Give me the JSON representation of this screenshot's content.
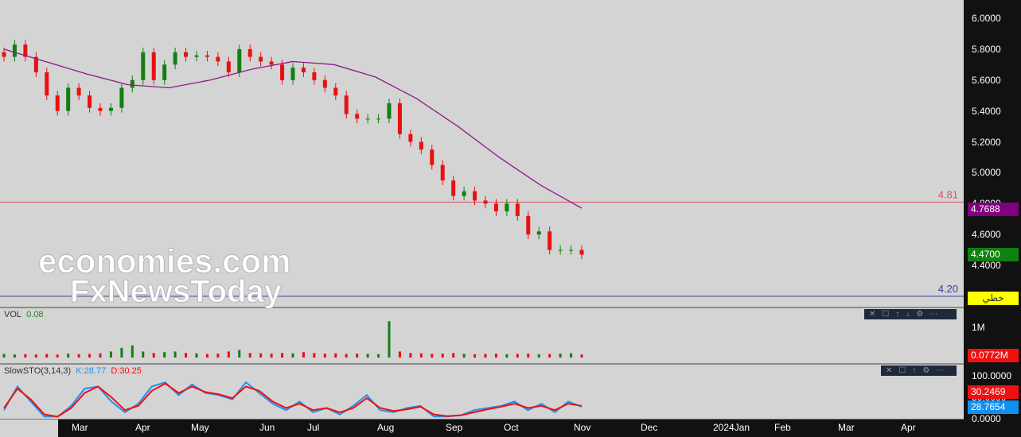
{
  "chart_data": {
    "type": "candlestick",
    "price_axis": {
      "ticks": [
        "6.0000",
        "5.8000",
        "5.6000",
        "5.4000",
        "5.2000",
        "5.0000",
        "4.8000",
        "4.6000",
        "4.4000"
      ],
      "range": [
        4.14,
        6.1
      ]
    },
    "x_ticks": [
      "Mar",
      "Apr",
      "May",
      "Jun",
      "Jul",
      "Aug",
      "Sep",
      "Oct",
      "Nov",
      "Dec",
      "2024Jan",
      "Feb",
      "Mar",
      "Apr"
    ],
    "closes": [
      5.75,
      5.83,
      5.75,
      5.65,
      5.5,
      5.4,
      5.55,
      5.5,
      5.42,
      5.4,
      5.42,
      5.55,
      5.6,
      5.78,
      5.6,
      5.7,
      5.78,
      5.75,
      5.76,
      5.75,
      5.72,
      5.65,
      5.8,
      5.75,
      5.72,
      5.7,
      5.6,
      5.68,
      5.65,
      5.6,
      5.55,
      5.5,
      5.38,
      5.35,
      5.35,
      5.35,
      5.45,
      5.25,
      5.2,
      5.15,
      5.05,
      4.95,
      4.85,
      4.88,
      4.82,
      4.8,
      4.75,
      4.8,
      4.72,
      4.6,
      4.62,
      4.5,
      4.5,
      4.5,
      4.47
    ],
    "ma": [
      5.8,
      5.72,
      5.64,
      5.57,
      5.55,
      5.6,
      5.67,
      5.72,
      5.7,
      5.62,
      5.48,
      5.3,
      5.1,
      4.92,
      4.77
    ],
    "h_lines": [
      {
        "value": 4.81,
        "label": "4.81",
        "color": "#e05060"
      },
      {
        "value": 4.2,
        "label": "4.20",
        "color": "#3040a0"
      }
    ],
    "tags": {
      "ma": "4.7688",
      "last": "4.4700",
      "alert": "خطي"
    },
    "volume": {
      "label": "VOL",
      "value": "0.08",
      "ticks": [
        "1M"
      ],
      "last": "0.0772M",
      "values": [
        0.12,
        0.1,
        0.11,
        0.1,
        0.12,
        0.1,
        0.13,
        0.11,
        0.12,
        0.14,
        0.2,
        0.32,
        0.4,
        0.2,
        0.15,
        0.18,
        0.2,
        0.15,
        0.14,
        0.12,
        0.13,
        0.2,
        0.25,
        0.15,
        0.14,
        0.13,
        0.15,
        0.14,
        0.18,
        0.15,
        0.13,
        0.14,
        0.12,
        0.13,
        0.12,
        0.11,
        1.2,
        0.2,
        0.15,
        0.14,
        0.12,
        0.13,
        0.15,
        0.12,
        0.11,
        0.12,
        0.13,
        0.11,
        0.12,
        0.13,
        0.11,
        0.12,
        0.13,
        0.14,
        0.1
      ]
    },
    "stoch": {
      "label": "SlowSTO(3,14,3)",
      "k_label": "K:28.77",
      "d_label": "D:30.25",
      "ticks": [
        "100.0000",
        "50.0000",
        "0.0000"
      ],
      "k_last": "28.7654",
      "d_last": "30.2469",
      "k": [
        20,
        75,
        40,
        5,
        5,
        30,
        70,
        75,
        40,
        15,
        35,
        75,
        85,
        55,
        80,
        60,
        55,
        45,
        85,
        60,
        35,
        20,
        40,
        15,
        25,
        10,
        30,
        55,
        20,
        15,
        25,
        30,
        5,
        5,
        8,
        20,
        25,
        30,
        40,
        20,
        35,
        15,
        40,
        28
      ],
      "d": [
        25,
        70,
        45,
        10,
        5,
        25,
        60,
        75,
        50,
        20,
        30,
        65,
        82,
        60,
        75,
        62,
        57,
        48,
        75,
        65,
        40,
        25,
        35,
        20,
        25,
        15,
        25,
        48,
        25,
        18,
        22,
        28,
        10,
        6,
        8,
        15,
        22,
        28,
        35,
        25,
        30,
        20,
        35,
        30
      ]
    },
    "colors": {
      "up": "#108010",
      "down": "#e81010",
      "ma": "#8b1a8b",
      "k": "#2090f0",
      "d": "#f01010"
    }
  },
  "watermark": {
    "line1": "economies.com",
    "line2": "FxNewsToday"
  },
  "toolbar_icons": [
    "close-icon",
    "maximize-icon",
    "move-up-icon",
    "move-down-icon",
    "settings-icon",
    "more-icon"
  ]
}
